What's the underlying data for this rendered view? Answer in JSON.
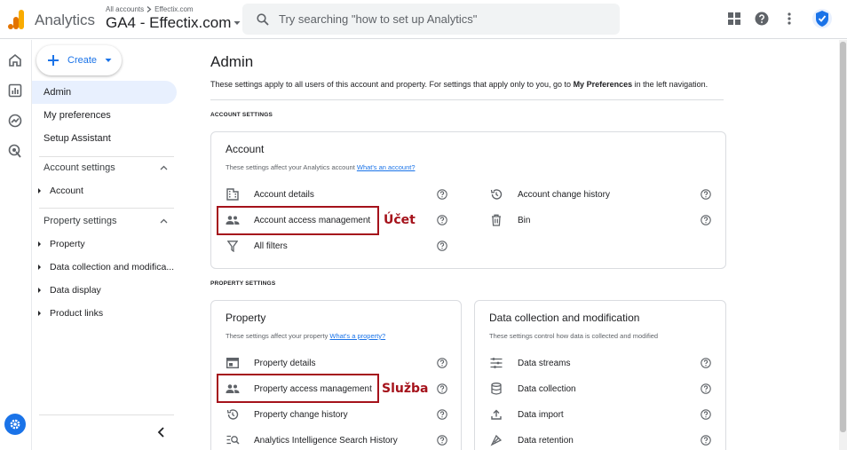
{
  "header": {
    "app_name": "Analytics",
    "breadcrumb_all": "All accounts",
    "breadcrumb_account": "Effectix.com",
    "property_name": "GA4 - Effectix.com",
    "search_placeholder": "Try searching \"how to set up Analytics\""
  },
  "nav": {
    "create_label": "Create",
    "items": {
      "admin": "Admin",
      "preferences": "My preferences",
      "setup": "Setup Assistant"
    },
    "account_settings": "Account settings",
    "account_sub": [
      "Account"
    ],
    "property_settings": "Property settings",
    "property_sub": [
      "Property",
      "Data collection and modifica...",
      "Data display",
      "Product links"
    ]
  },
  "main": {
    "title": "Admin",
    "intro_pre": "These settings apply to all users of this account and property. For settings that apply only to you, go to ",
    "intro_bold": "My Preferences",
    "intro_post": " in the left navigation.",
    "account_section_label": "ACCOUNT SETTINGS",
    "property_section_label": "PROPERTY SETTINGS",
    "account_card": {
      "title": "Account",
      "desc": "These settings affect your Analytics account ",
      "desc_link": "What's an account?",
      "left_rows": [
        "Account details",
        "Account access management",
        "All filters"
      ],
      "right_rows": [
        "Account change history",
        "Bin"
      ]
    },
    "property_card": {
      "title": "Property",
      "desc": "These settings affect your property ",
      "desc_link": "What's a property?",
      "rows": [
        "Property details",
        "Property access management",
        "Property change history",
        "Analytics Intelligence Search History"
      ]
    },
    "data_card": {
      "title": "Data collection and modification",
      "desc": "These settings control how data is collected and modified",
      "rows": [
        "Data streams",
        "Data collection",
        "Data import",
        "Data retention"
      ]
    },
    "annotations": {
      "account_label": "Účet",
      "property_label": "Služba",
      "color": "#a5121b"
    }
  },
  "colors": {
    "accent": "#1a73e8",
    "logo_orange": "#f9ab00",
    "logo_dark": "#e37400"
  }
}
